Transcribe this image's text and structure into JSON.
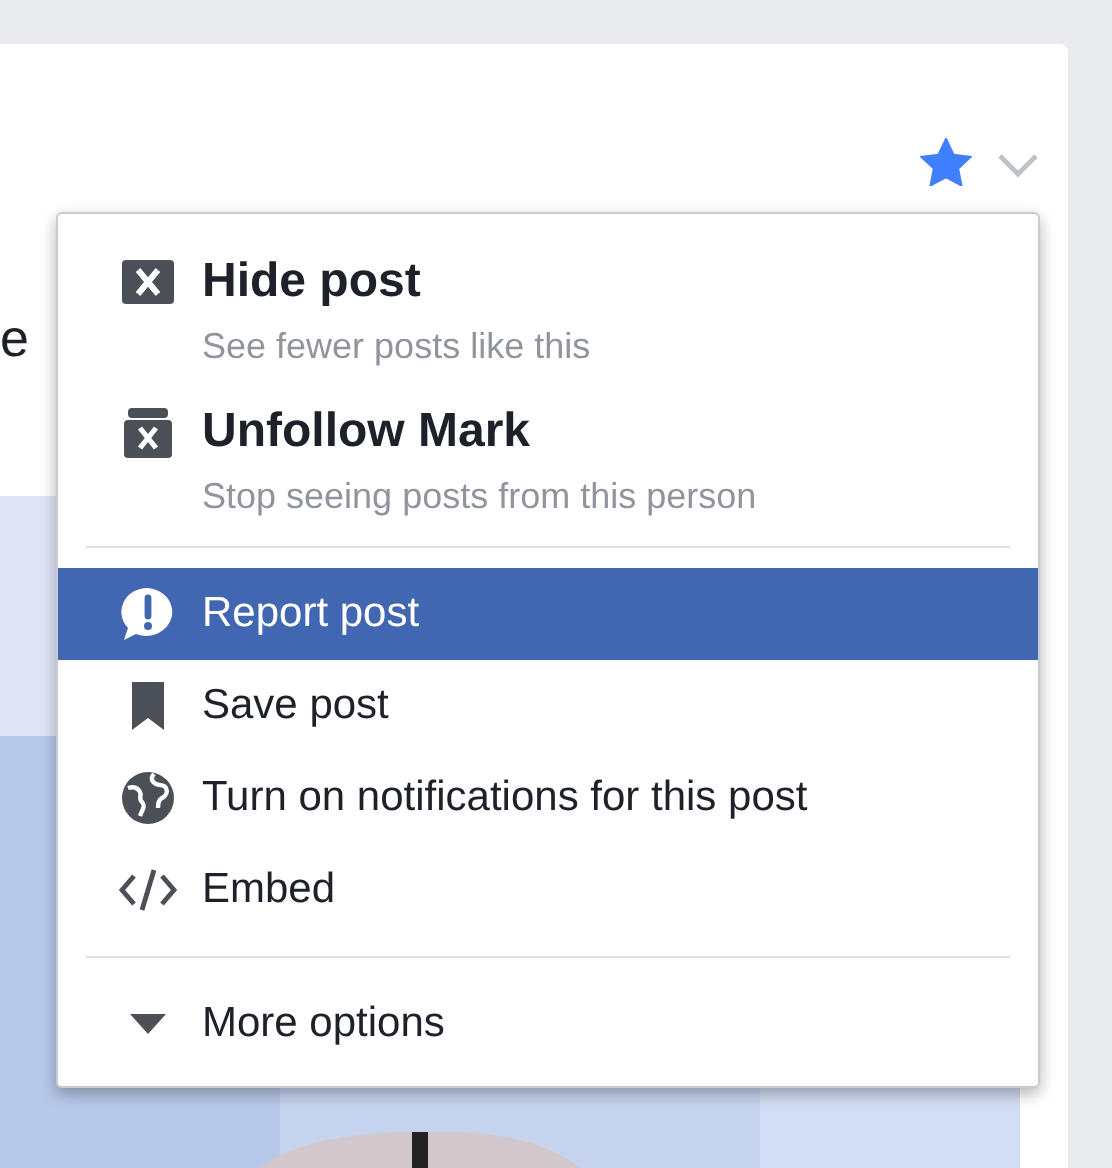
{
  "post": {
    "text_fragment": "e",
    "starred": true
  },
  "menu": {
    "groups": [
      {
        "items": [
          {
            "kind": "primary",
            "title": "Hide post",
            "subtitle": "See fewer posts like this",
            "selected": false
          },
          {
            "kind": "primary",
            "title": "Unfollow Mark",
            "subtitle": "Stop seeing posts from this person",
            "selected": false
          }
        ]
      },
      {
        "items": [
          {
            "kind": "action",
            "label": "Report post",
            "selected": true
          },
          {
            "kind": "action",
            "label": "Save post",
            "selected": false
          },
          {
            "kind": "action",
            "label": "Turn on notifications for this post",
            "selected": false
          },
          {
            "kind": "action",
            "label": "Embed",
            "selected": false
          }
        ]
      },
      {
        "items": [
          {
            "kind": "more",
            "label": "More options",
            "selected": false
          }
        ]
      }
    ]
  }
}
